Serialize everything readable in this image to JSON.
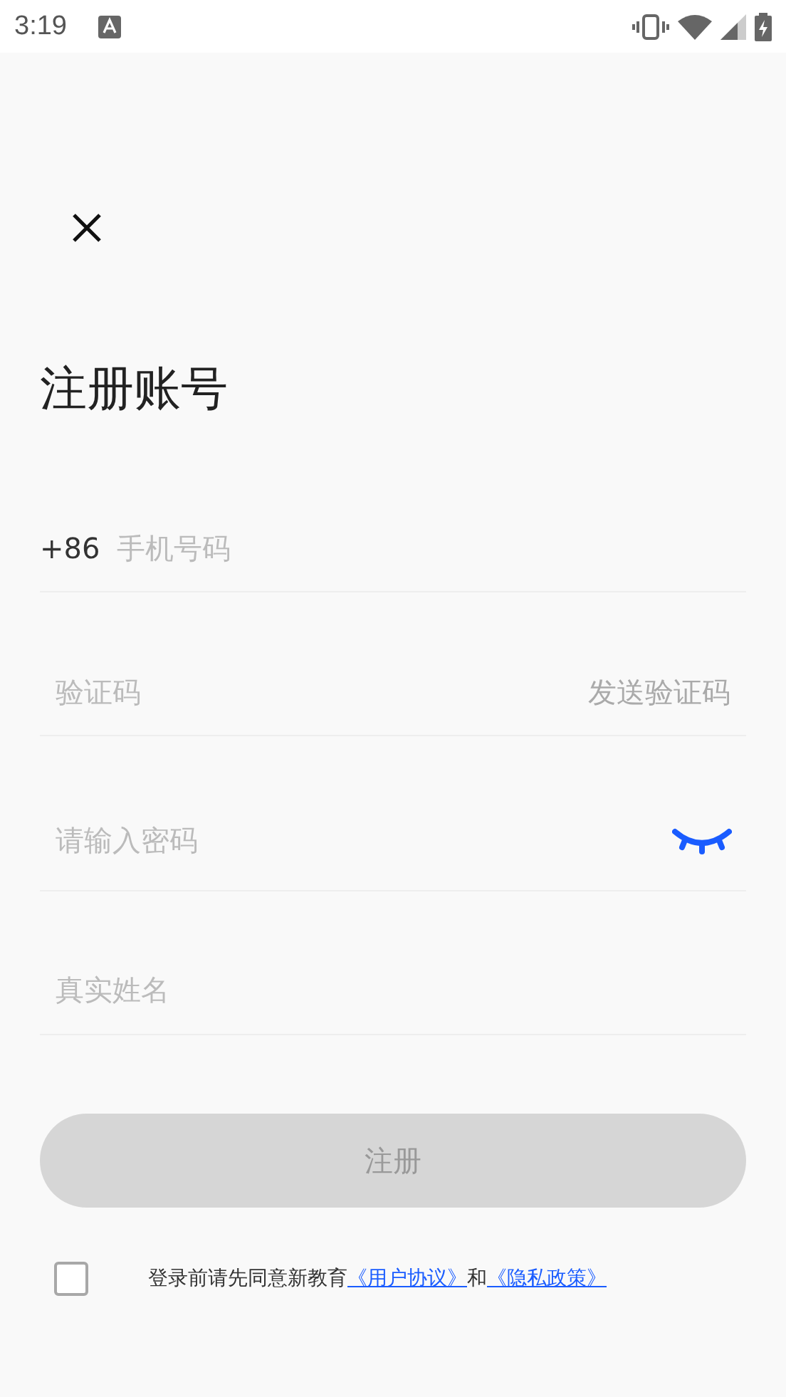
{
  "status_bar": {
    "time": "3:19"
  },
  "title": "注册账号",
  "fields": [
    {
      "kind": "phone",
      "prefix": "+86",
      "placeholder": "手机号码"
    },
    {
      "kind": "code",
      "placeholder": "验证码",
      "action": "发送验证码"
    },
    {
      "kind": "password",
      "placeholder": "请输入密码"
    },
    {
      "kind": "text",
      "placeholder": "真实姓名"
    }
  ],
  "submit": {
    "label": "注册",
    "disabled": true
  },
  "agreement": {
    "checked": false,
    "text": "登录前请先同意新教育",
    "links": [
      "《用户协议》",
      "《隐私政策》"
    ],
    "joiner": "和"
  }
}
